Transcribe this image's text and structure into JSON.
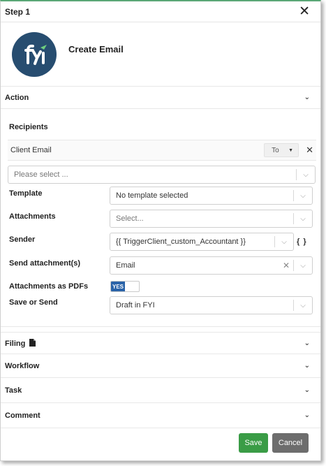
{
  "header": {
    "title": "Step 1"
  },
  "action": {
    "title": "Create Email"
  },
  "sections": {
    "action": "Action",
    "filing": "Filing",
    "workflow": "Workflow",
    "task": "Task",
    "comment": "Comment"
  },
  "recipients": {
    "label": "Recipients",
    "rows": [
      {
        "name": "Client Email",
        "type": "To"
      }
    ],
    "add_placeholder": "Please select ..."
  },
  "fields": {
    "template": {
      "label": "Template",
      "value": "No template selected"
    },
    "attachments": {
      "label": "Attachments",
      "placeholder": "Select..."
    },
    "sender": {
      "label": "Sender",
      "value": "{{ TriggerClient_custom_Accountant }}",
      "braces": "{ }"
    },
    "send_attachments": {
      "label": "Send attachment(s)",
      "value": "Email"
    },
    "attachments_pdf": {
      "label": "Attachments as PDFs",
      "toggle_label": "YES",
      "enabled": true
    },
    "save_or_send": {
      "label": "Save or Send",
      "value": "Draft in FYI"
    }
  },
  "buttons": {
    "save": "Save",
    "cancel": "Cancel"
  },
  "icons": {
    "close": "close-icon",
    "chevron": "chevron-down-icon",
    "filing": "document-icon"
  },
  "colors": {
    "accent_top": "#5aa776",
    "logo_bg": "#274d70",
    "logo_leaf": "#6fcf7f",
    "toggle_on": "#2a63a8",
    "save_btn": "#3a9c46",
    "cancel_btn": "#6d6d6d"
  }
}
